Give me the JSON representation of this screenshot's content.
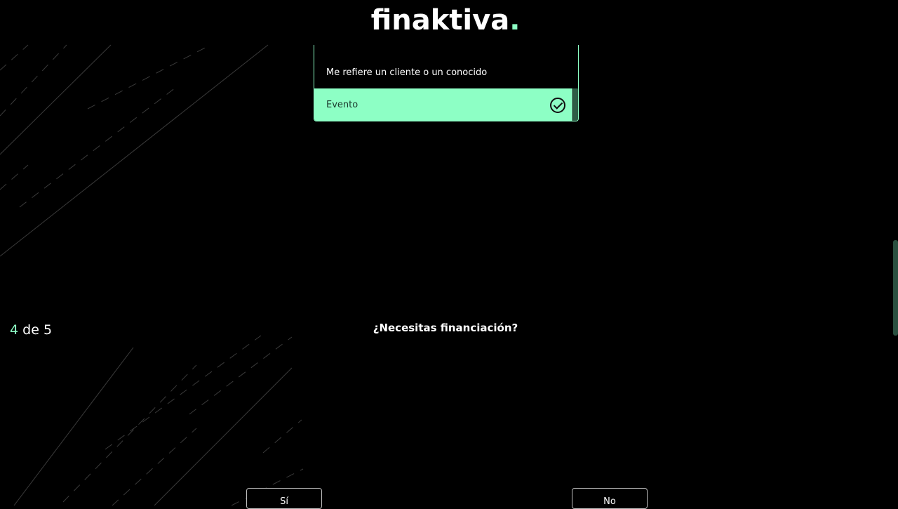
{
  "brand": {
    "logo_text": "finaktiva",
    "logo_dot": ".",
    "accent_color": "#8dffc5"
  },
  "options": [
    {
      "label": "Me refiere un cliente o un conocido",
      "selected": false
    },
    {
      "label": "Evento",
      "selected": true
    }
  ],
  "progress": {
    "current": "4",
    "separator": " de ",
    "total": "5"
  },
  "question": {
    "text": "¿Necesitas financiación?"
  },
  "answers": {
    "yes_label": "Sí",
    "no_label": "No"
  }
}
